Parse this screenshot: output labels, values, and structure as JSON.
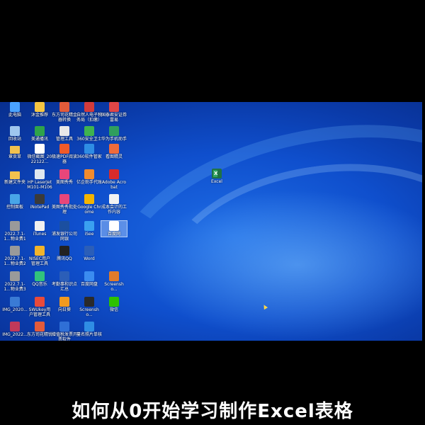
{
  "desktop": {
    "icons": [
      {
        "label": "此电脑",
        "icon": "computer-icon",
        "color": "#4aa3ff",
        "col": 0,
        "row": 0
      },
      {
        "label": "沐金推荐",
        "icon": "app-icon",
        "color": "#f5c542",
        "col": 1,
        "row": 0
      },
      {
        "label": "东方司花精金器转换",
        "icon": "app-icon",
        "color": "#e35b3a",
        "col": 2,
        "row": 0
      },
      {
        "label": "自然人电子税务局（扣缴）",
        "icon": "tax-icon",
        "color": "#d23b3b",
        "col": 3,
        "row": 0
      },
      {
        "label": "国泰君安证券富易",
        "icon": "stock-icon",
        "color": "#e04646",
        "col": 4,
        "row": 0
      },
      {
        "label": "回收站",
        "icon": "recycle-bin-icon",
        "color": "#9fc6ee",
        "col": 0,
        "row": 1
      },
      {
        "label": "美通播讯",
        "icon": "app-icon",
        "color": "#2fa34a",
        "col": 1,
        "row": 1
      },
      {
        "label": "管理工具",
        "icon": "tools-icon",
        "color": "#e8e8e8",
        "col": 2,
        "row": 1
      },
      {
        "label": "360安全卫士",
        "icon": "shield-icon",
        "color": "#3fb34f",
        "col": 3,
        "row": 1
      },
      {
        "label": "华为手机助手",
        "icon": "phone-icon",
        "color": "#2f9e5e",
        "col": 4,
        "row": 1
      },
      {
        "label": "章贡草",
        "icon": "folder-icon",
        "color": "#f2c14e",
        "col": 0,
        "row": 2
      },
      {
        "label": "微信截图_2022122...",
        "icon": "image-icon",
        "color": "#ffffff",
        "col": 1,
        "row": 2
      },
      {
        "label": "极速PDF阅读器",
        "icon": "pdf-icon",
        "color": "#f05a28",
        "col": 2,
        "row": 2
      },
      {
        "label": "360软件管家",
        "icon": "store-icon",
        "color": "#2f8de4",
        "col": 3,
        "row": 2
      },
      {
        "label": "看图精灵",
        "icon": "viewer-icon",
        "color": "#ef6b3a",
        "col": 4,
        "row": 2
      },
      {
        "label": "新建文件夹",
        "icon": "folder-icon",
        "color": "#f2c14e",
        "col": 0,
        "row": 3
      },
      {
        "label": "HP LaserJet M101-M106",
        "icon": "printer-icon",
        "color": "#dfe7ef",
        "col": 1,
        "row": 3
      },
      {
        "label": "美图秀秀",
        "icon": "photo-app-icon",
        "color": "#e8467a",
        "col": 2,
        "row": 3
      },
      {
        "label": "亿企助手代账",
        "icon": "app-icon",
        "color": "#f08b2e",
        "col": 3,
        "row": 3
      },
      {
        "label": "Adobe Acrobat",
        "icon": "acrobat-icon",
        "color": "#d82b2b",
        "col": 4,
        "row": 3
      },
      {
        "label": "控制面板",
        "icon": "control-panel-icon",
        "color": "#48a6e8",
        "col": 0,
        "row": 4
      },
      {
        "label": "iNotePad",
        "icon": "notepad-icon",
        "color": "#3a3a3a",
        "col": 1,
        "row": 4
      },
      {
        "label": "美图秀秀批处理",
        "icon": "photo-app-icon",
        "color": "#e8467a",
        "col": 2,
        "row": 4
      },
      {
        "label": "Google Chrome",
        "icon": "chrome-icon",
        "color": "#f4b400",
        "col": 3,
        "row": 4
      },
      {
        "label": "成本会计的工作内容",
        "icon": "document-icon",
        "color": "#f2f2f2",
        "col": 4,
        "row": 4
      },
      {
        "label": "2022.7.1-1...物业费1",
        "icon": "image-icon",
        "color": "#9a9a9a",
        "col": 0,
        "row": 5
      },
      {
        "label": "iTunes",
        "icon": "music-icon",
        "color": "#f0f0f0",
        "col": 1,
        "row": 5
      },
      {
        "label": "浦发银行公司网银",
        "icon": "bank-icon",
        "color": "#1b4fa0",
        "col": 2,
        "row": 5
      },
      {
        "label": "iSee",
        "icon": "app-icon",
        "color": "#3aa0f0",
        "col": 3,
        "row": 5
      },
      {
        "label": "百度网",
        "icon": "baidu-icon",
        "color": "#ffffff",
        "col": 4,
        "row": 5
      },
      {
        "label": "2022.7.1-1...物业费2",
        "icon": "image-icon",
        "color": "#9a9a9a",
        "col": 0,
        "row": 6
      },
      {
        "label": "NISEC用户管理工具",
        "icon": "user-tool-icon",
        "color": "#f2b42a",
        "col": 1,
        "row": 6
      },
      {
        "label": "腾讯QQ",
        "icon": "qq-icon",
        "color": "#222222",
        "col": 2,
        "row": 6
      },
      {
        "label": "Word",
        "icon": "word-icon",
        "color": "#2b5eb8",
        "col": 3,
        "row": 6
      },
      {
        "label": "2022.7.1-1...物业费3",
        "icon": "image-icon",
        "color": "#9a9a9a",
        "col": 0,
        "row": 7
      },
      {
        "label": "QQ音乐",
        "icon": "music-app-icon",
        "color": "#31c27c",
        "col": 1,
        "row": 7
      },
      {
        "label": "考勤事和识点汇总",
        "icon": "document-icon",
        "color": "#2b5eb8",
        "col": 2,
        "row": 7
      },
      {
        "label": "百度网盘",
        "icon": "cloud-icon",
        "color": "#3b8cf0",
        "col": 3,
        "row": 7
      },
      {
        "label": "Screensho...",
        "icon": "image-icon",
        "color": "#e07b2a",
        "col": 4,
        "row": 7
      },
      {
        "label": "IMG_2020...",
        "icon": "image-icon",
        "color": "#3a7bd5",
        "col": 0,
        "row": 8
      },
      {
        "label": "SWUkey用户管理工具",
        "icon": "key-icon",
        "color": "#e84a3a",
        "col": 1,
        "row": 8
      },
      {
        "label": "向日葵",
        "icon": "sunflower-icon",
        "color": "#f39a1e",
        "col": 2,
        "row": 8
      },
      {
        "label": "Screensho...",
        "icon": "image-icon",
        "color": "#2a2a2a",
        "col": 3,
        "row": 8
      },
      {
        "label": "微信",
        "icon": "wechat-icon",
        "color": "#2dc100",
        "col": 4,
        "row": 8
      },
      {
        "label": "IMG_2022...",
        "icon": "image-icon",
        "color": "#c0395a",
        "col": 0,
        "row": 9
      },
      {
        "label": "东方司花精锐",
        "icon": "app-icon",
        "color": "#e35b3a",
        "col": 1,
        "row": 9
      },
      {
        "label": "增值税发票开票软件",
        "icon": "invoice-icon",
        "color": "#2f6fd6",
        "col": 2,
        "row": 9
      },
      {
        "label": "蔓名照片单核",
        "icon": "app-icon",
        "color": "#2f8de4",
        "col": 3,
        "row": 9
      }
    ],
    "excel_shortcut": {
      "label": "Excel",
      "icon": "excel-icon",
      "color": "#1f7244"
    }
  },
  "caption": "如何从0开始学习制作Excel表格"
}
